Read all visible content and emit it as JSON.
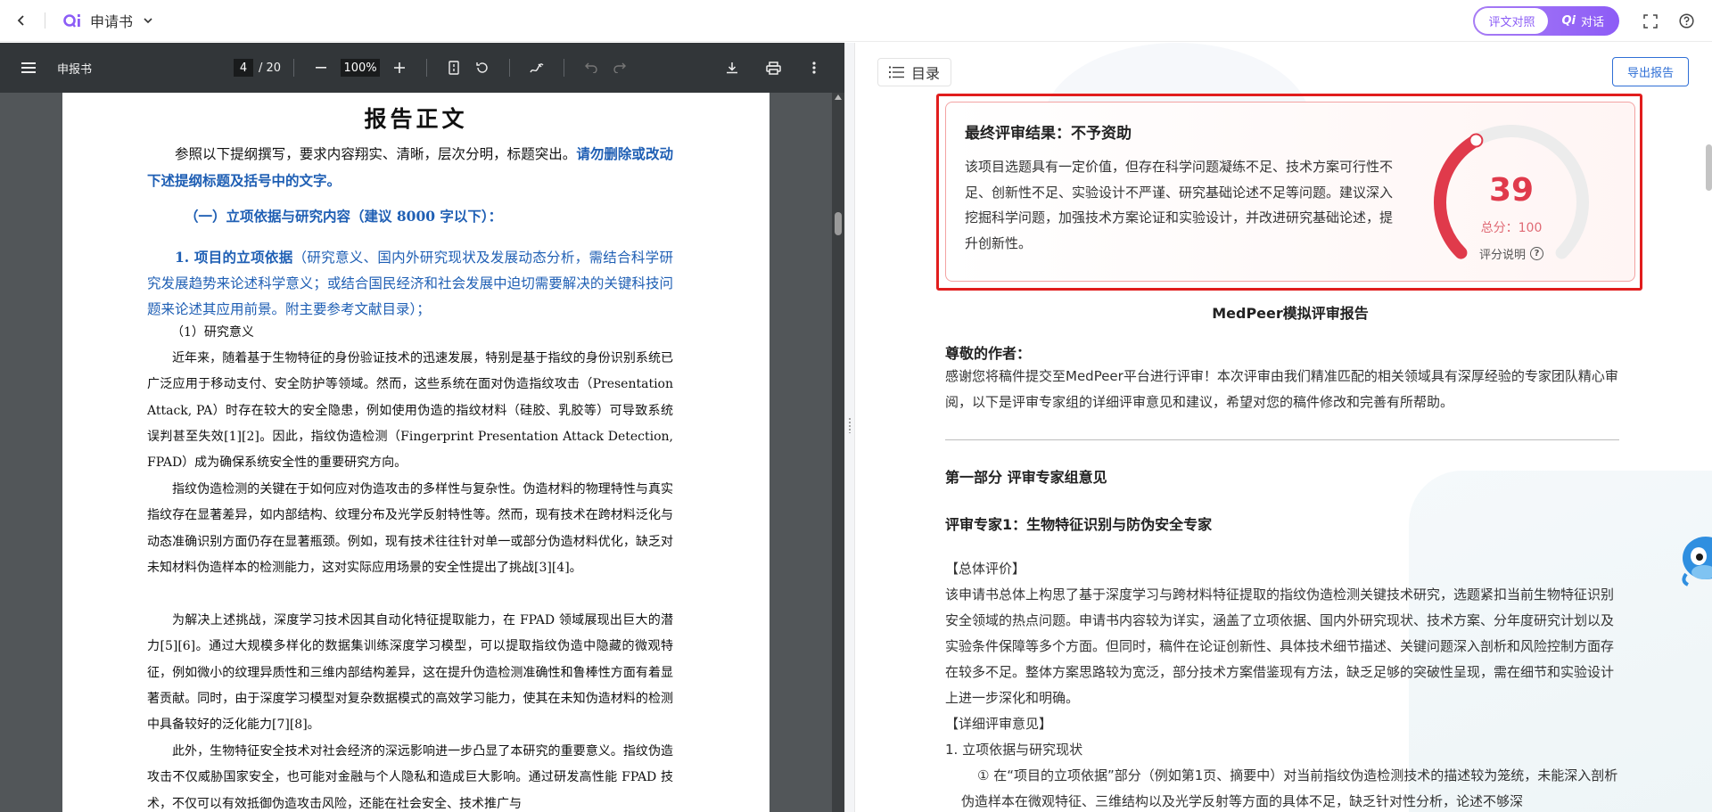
{
  "app": {
    "title": "申请书",
    "segments": {
      "compare_label": "评文对照",
      "chat_label": "对话",
      "ai_badge": "Qi"
    }
  },
  "pdf": {
    "filename": "申报书",
    "current_page": "4",
    "total_pages": "/ 20",
    "zoom": "100%",
    "page": {
      "heading": "报告正文",
      "intro_normal": "参照以下提纲撰写，要求内容翔实、清晰，层次分明，标题突出。",
      "intro_blue": "请勿删除或改动下述提纲标题及括号中的文字。",
      "section1": "（一）立项依据与研究内容（建议 8000 字以下）：",
      "item1_bold": "1. 项目的立项依据",
      "item1_normal": "（研究意义、国内外研究现状及发展动态分析，需结合科学研究发展趋势来论述科学意义；或结合国民经济和社会发展中迫切需要解决的关键科技问题来论述其应用前景。附主要参考文献目录）；",
      "sub1": "（1）研究意义",
      "para1": "近年来，随着基于生物特征的身份验证技术的迅速发展，特别是基于指纹的身份识别系统已广泛应用于移动支付、安全防护等领域。然而，这些系统在面对伪造指纹攻击（Presentation Attack, PA）时存在较大的安全隐患，例如使用伪造的指纹材料（硅胶、乳胶等）可导致系统误判甚至失效[1][2]。因此，指纹伪造检测（Fingerprint Presentation Attack Detection, FPAD）成为确保系统安全性的重要研究方向。",
      "para2": "指纹伪造检测的关键在于如何应对伪造攻击的多样性与复杂性。伪造材料的物理特性与真实指纹存在显著差异，如内部结构、纹理分布及光学反射特性等。然而，现有技术在跨材料泛化与动态准确识别方面仍存在显著瓶颈。例如，现有技术往往针对单一或部分伪造材料优化，缺乏对未知材料伪造样本的检测能力，这对实际应用场景的安全性提出了挑战[3][4]。",
      "para3": "为解决上述挑战，深度学习技术因其自动化特征提取能力，在 FPAD 领域展现出巨大的潜力[5][6]。通过大规模多样化的数据集训练深度学习模型，可以提取指纹伪造中隐藏的微观特征，例如微小的纹理异质性和三维内部结构差异，这在提升伪造检测准确性和鲁棒性方面有着显著贡献。同时，由于深度学习模型对复杂数据模式的高效学习能力，使其在未知伪造材料的检测中具备较好的泛化能力[7][8]。",
      "para4": "此外，生物特征安全技术对社会经济的深远影响进一步凸显了本研究的重要意义。指纹伪造攻击不仅威胁国家安全，也可能对金融与个人隐私和造成巨大影响。通过研发高性能 FPAD 技术，不仅可以有效抵御伪造攻击风险，还能在社会安全、技术推广与"
    }
  },
  "report": {
    "toc_label": "目录",
    "export_label": "导出报告",
    "result": {
      "title": "最终评审结果：不予资助",
      "text": "该项目选题具有一定价值，但存在科学问题凝练不足、技术方案可行性不足、创新性不足、实验设计不严谨、研究基础论述不足等问题。建议深入挖掘科学问题，加强技术方案论证和实验设计，并改进研究基础论述，提升创新性。",
      "score": "39",
      "score_value": 39,
      "score_max": 100,
      "total_label": "总分：100",
      "help_label": "评分说明",
      "gauge_color": "#e03a4b"
    },
    "report_title": "MedPeer模拟评审报告",
    "greeting": "尊敬的作者：",
    "greeting_text": "感谢您将稿件提交至MedPeer平台进行评审！本次评审由我们精准匹配的相关领域具有深厚经验的专家团队精心审阅，以下是评审专家组的详细评审意见和建议，希望对您的稿件修改和完善有所帮助。",
    "part1": "第一部分 评审专家组意见",
    "expert1": "评审专家1：生物特征识别与防伪安全专家",
    "overall_label": "【总体评价】",
    "overall_text": "该申请书总体上构思了基于深度学习与跨材料特征提取的指纹伪造检测关键技术研究，选题紧扣当前生物特征识别安全领域的热点问题。申请书内容较为详实，涵盖了立项依据、国内外研究现状、技术方案、分年度研究计划以及实验条件保障等多个方面。但同时，稿件在论证创新性、具体技术细节描述、关键问题深入剖析和风险控制方面存在较多不足。整体方案思路较为宽泛，部分技术方案借鉴现有方法，缺乏足够的突破性呈现，需在细节和实验设计上进一步深化和明确。",
    "detail_label": "【详细评审意见】",
    "detail_item1": "1. 立项依据与研究现状",
    "detail_item1_text": "① 在“项目的立项依据”部分（例如第1页、摘要中）对当前指纹伪造检测技术的描述较为笼统，未能深入剖析伪造样本在微观特征、三维结构以及光学反射等方面的具体不足，缺乏针对性分析，论述不够深"
  }
}
